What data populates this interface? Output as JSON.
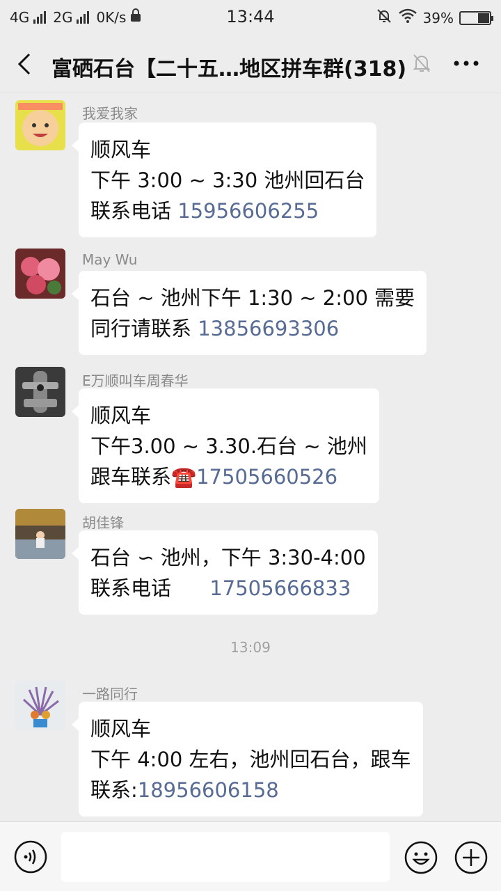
{
  "status_bar": {
    "net1": "4G",
    "net2": "2G",
    "speed": "0K/s",
    "time": "13:44",
    "battery": "39%",
    "battery_level": 0.39,
    "icons": [
      "signal-icon",
      "lock-icon",
      "alarm-off-icon",
      "wifi-icon",
      "battery-icon"
    ]
  },
  "header": {
    "title": "富硒石台【二十五…地区拼车群(318)",
    "icons": [
      "back-icon",
      "mute-bell-icon",
      "more-icon"
    ]
  },
  "messages": [
    {
      "sender": "我爱我家",
      "lines": [
        "顺风车",
        "下午 3:00 ~ 3:30 池州回石台"
      ],
      "last_prefix": "联系电话 ",
      "phone": "15956606255"
    },
    {
      "sender": "May Wu",
      "lines": [
        "石台 ~ 池州下午 1:30 ~ 2:00  需要"
      ],
      "last_prefix": "同行请联系 ",
      "phone": "13856693306"
    },
    {
      "sender": "E万顺叫车周春华",
      "lines": [
        "顺风车",
        "下午3.00 ~ 3.30.石台 ~ 池州"
      ],
      "last_prefix": "跟车联系☎️",
      "phone": "17505660526"
    },
    {
      "sender": "胡佳锋",
      "lines": [
        "石台 ∽ 池州，下午 3:30-4:00"
      ],
      "last_prefix": "联系电话      ",
      "phone": "17505666833"
    },
    {
      "sender": "一路同行",
      "lines": [
        "顺风车",
        "下午 4:00 左右，池州回石台，跟车"
      ],
      "last_prefix": "联系:",
      "phone": "18956606158"
    }
  ],
  "time_separator": "13:09",
  "input": {
    "placeholder": ""
  },
  "colors": {
    "background": "#ededed",
    "bubble": "#ffffff",
    "link": "#576b95",
    "sender": "#8a8a8a"
  }
}
